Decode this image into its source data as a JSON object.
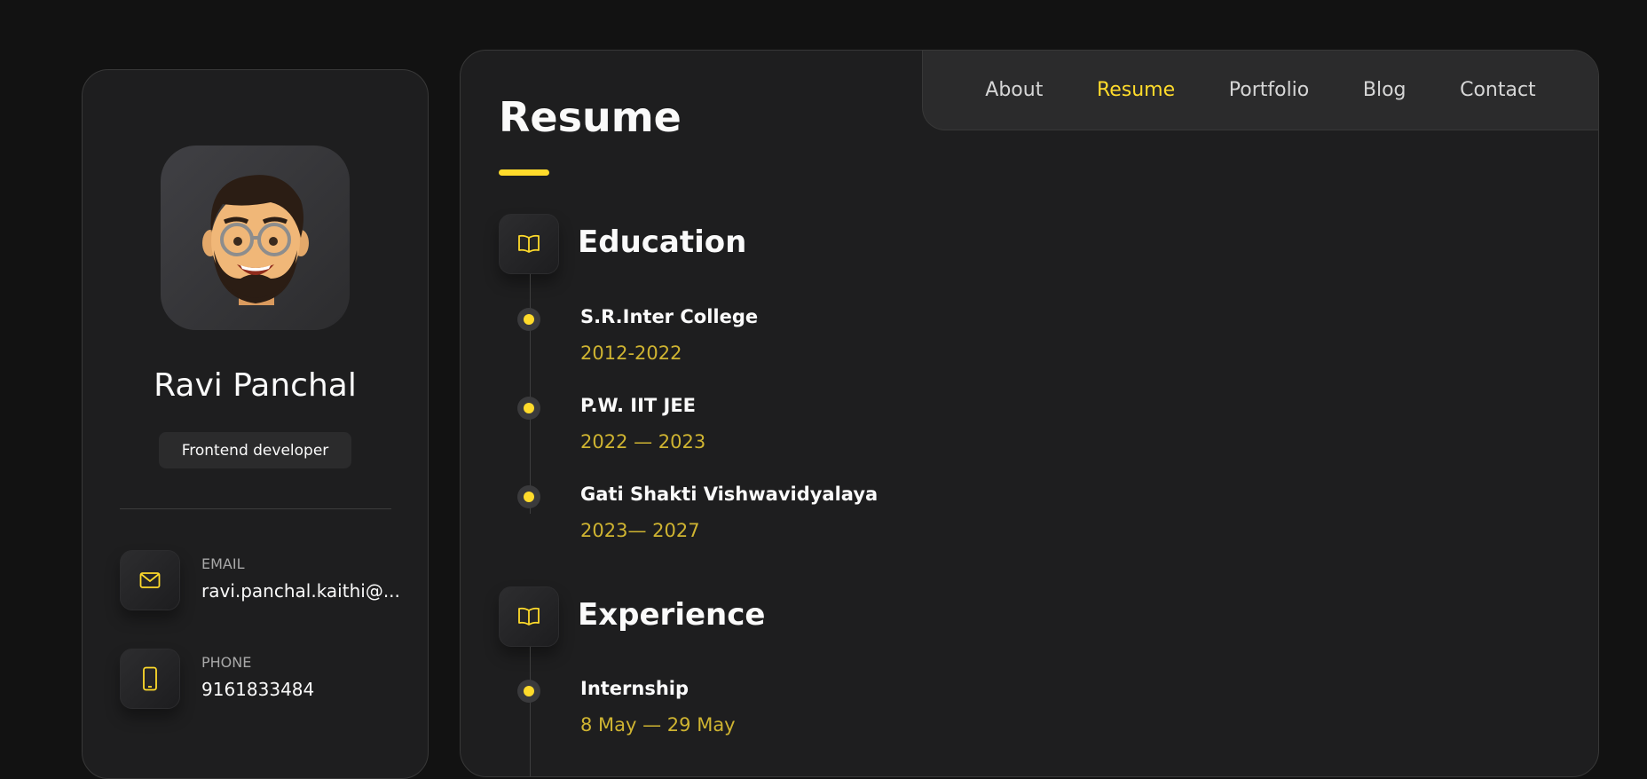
{
  "profile": {
    "name": "Ravi Panchal",
    "role": "Frontend developer",
    "avatar_icon": "memoji-avatar"
  },
  "contacts": [
    {
      "label": "EMAIL",
      "value": "ravi.panchal.kaithi@...",
      "icon": "mail-icon"
    },
    {
      "label": "PHONE",
      "value": "9161833484",
      "icon": "phone-icon"
    }
  ],
  "nav": {
    "items": [
      {
        "label": "About",
        "active": false
      },
      {
        "label": "Resume",
        "active": true
      },
      {
        "label": "Portfolio",
        "active": false
      },
      {
        "label": "Blog",
        "active": false
      },
      {
        "label": "Contact",
        "active": false
      }
    ]
  },
  "page": {
    "title": "Resume"
  },
  "education": {
    "title": "Education",
    "icon": "book-icon",
    "items": [
      {
        "title": "S.R.Inter College",
        "date": "2012-2022"
      },
      {
        "title": "P.W. IIT JEE",
        "date": "2022 — 2023"
      },
      {
        "title": "Gati Shakti Vishwavidyalaya",
        "date": "2023— 2027"
      }
    ]
  },
  "experience": {
    "title": "Experience",
    "icon": "book-icon",
    "items": [
      {
        "title": "Internship",
        "date": "8 May — 29 May"
      }
    ]
  },
  "colors": {
    "accent": "#ffdb2b",
    "date": "#cfb431",
    "background": "#121212",
    "panel": "#1e1e1f"
  }
}
